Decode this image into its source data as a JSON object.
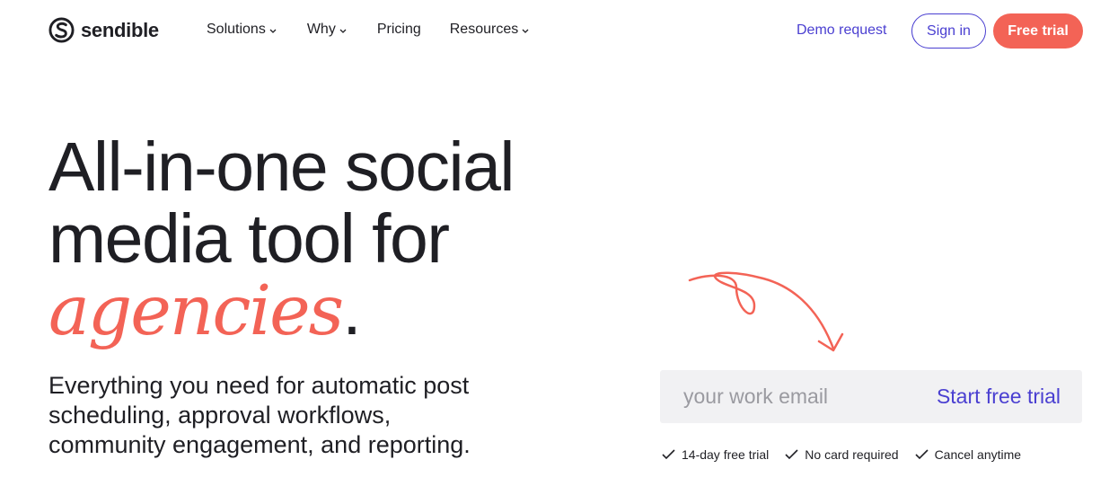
{
  "brand": {
    "name": "sendible",
    "accent": "#f36356",
    "primary": "#4a3fd1"
  },
  "nav": {
    "items": [
      {
        "label": "Solutions",
        "has_dropdown": true
      },
      {
        "label": "Why",
        "has_dropdown": true
      },
      {
        "label": "Pricing",
        "has_dropdown": false
      },
      {
        "label": "Resources",
        "has_dropdown": true
      }
    ]
  },
  "header_actions": {
    "demo_label": "Demo request",
    "signin_label": "Sign in",
    "trial_label": "Free trial"
  },
  "hero": {
    "headline_line1": "All-in-one social",
    "headline_line2": "media tool for",
    "headline_accent": "agencies",
    "headline_period": ".",
    "subtext": "Everything you need for automatic post scheduling, approval workflows, community engagement, and reporting."
  },
  "signup": {
    "email_placeholder": "your work email",
    "cta_label": "Start free trial",
    "perks": [
      "14-day free trial",
      "No card required",
      "Cancel anytime"
    ]
  }
}
